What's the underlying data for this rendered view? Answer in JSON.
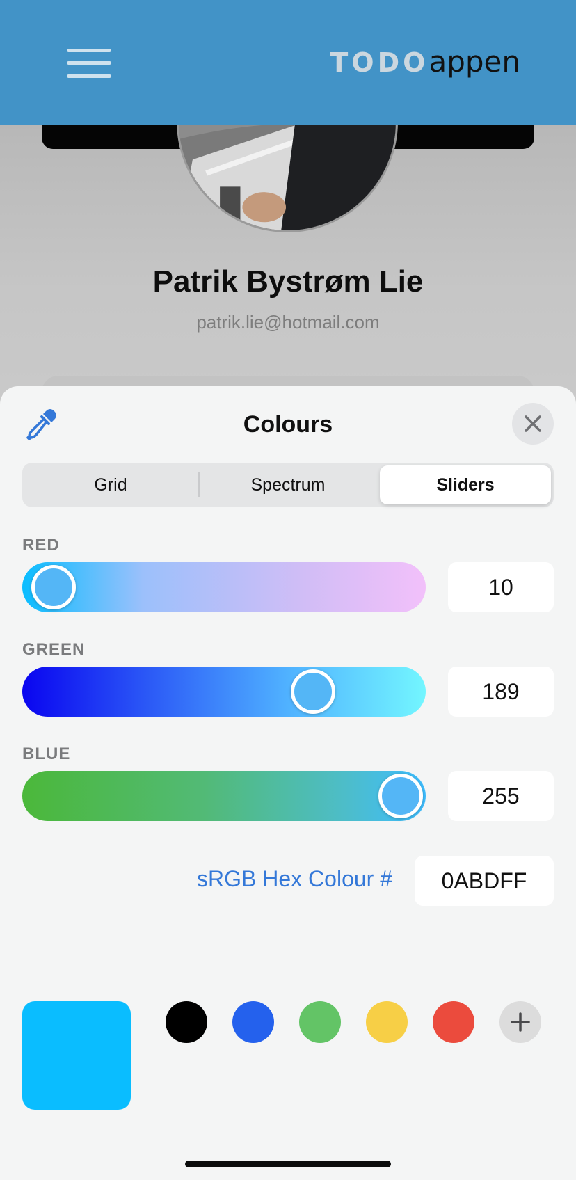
{
  "app": {
    "logo_bold": "TODO",
    "logo_light": "appen"
  },
  "profile": {
    "name": "Patrik Bystrøm Lie",
    "email": "patrik.lie@hotmail.com"
  },
  "color_picker": {
    "title": "Colours",
    "tabs": [
      {
        "label": "Grid",
        "selected": false
      },
      {
        "label": "Spectrum",
        "selected": false
      },
      {
        "label": "Sliders",
        "selected": true
      }
    ],
    "sliders": [
      {
        "label": "RED",
        "value": "10",
        "fraction": 0.04
      },
      {
        "label": "GREEN",
        "value": "189",
        "fraction": 0.74
      },
      {
        "label": "BLUE",
        "value": "255",
        "fraction": 1.0
      }
    ],
    "hex_label": "sRGB Hex Colour #",
    "hex_value": "0ABDFF",
    "current_color": "#0ABDFF",
    "presets": [
      "#000000",
      "#2461ED",
      "#63C466",
      "#F7CF46",
      "#EB4B3D"
    ]
  },
  "colors": {
    "header": "#4293C7",
    "accent": "#3478D8"
  }
}
